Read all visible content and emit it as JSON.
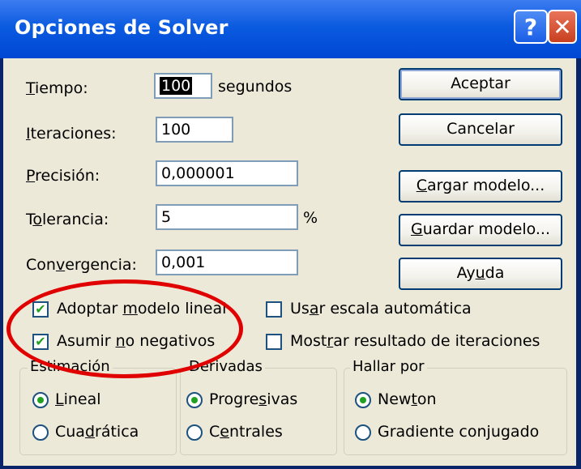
{
  "window": {
    "title": "Opciones de Solver",
    "help_glyph": "?",
    "close_glyph": "✕"
  },
  "fields": {
    "tiempo": {
      "label_pre": "",
      "label_ul": "T",
      "label_post": "iempo:",
      "value": "100",
      "unit": "segundos"
    },
    "iteraciones": {
      "label_pre": "",
      "label_ul": "I",
      "label_post": "teraciones:",
      "value": "100"
    },
    "precision": {
      "label_pre": "",
      "label_ul": "P",
      "label_post": "recisión:",
      "value": "0,000001"
    },
    "tolerancia": {
      "label_pre": "T",
      "label_ul": "o",
      "label_post": "lerancia:",
      "value": "5",
      "unit": "%"
    },
    "convergencia": {
      "label_pre": "Con",
      "label_ul": "v",
      "label_post": "ergencia:",
      "value": "0,001"
    }
  },
  "buttons": {
    "aceptar": "Aceptar",
    "cancelar": "Cancelar",
    "cargar_pre": "",
    "cargar_ul": "C",
    "cargar_post": "argar modelo...",
    "guardar_pre": "",
    "guardar_ul": "G",
    "guardar_post": "uardar modelo...",
    "ayuda_pre": "Ay",
    "ayuda_ul": "u",
    "ayuda_post": "da"
  },
  "checkboxes": {
    "lineal": {
      "pre": "Adoptar ",
      "ul": "m",
      "post": "odelo lineal",
      "checked": true
    },
    "no_negativos": {
      "pre": "Asumir ",
      "ul": "n",
      "post": "o negativos",
      "checked": true
    },
    "escala": {
      "pre": "Us",
      "ul": "a",
      "post": "r escala automática",
      "checked": false
    },
    "iteraciones": {
      "pre": "Most",
      "ul": "r",
      "post": "ar resultado de iteraciones",
      "checked": false
    }
  },
  "groups": {
    "estimacion": {
      "legend": "Estimación",
      "options": [
        {
          "pre": "",
          "ul": "L",
          "post": "ineal",
          "selected": true
        },
        {
          "pre": "Cua",
          "ul": "d",
          "post": "rática",
          "selected": false
        }
      ]
    },
    "derivadas": {
      "legend": "Derivadas",
      "options": [
        {
          "pre": "Progre",
          "ul": "s",
          "post": "ivas",
          "selected": true
        },
        {
          "pre": "C",
          "ul": "e",
          "post": "ntrales",
          "selected": false
        }
      ]
    },
    "hallar": {
      "legend": "Hallar por",
      "options": [
        {
          "pre": "New",
          "ul": "t",
          "post": "on",
          "selected": true
        },
        {
          "pre": "Gradiente con",
          "ul": "j",
          "post": "ugado",
          "selected": false
        }
      ]
    }
  },
  "colors": {
    "accent": "#0047d4",
    "annotation": "#e00000",
    "check": "#21a121"
  }
}
